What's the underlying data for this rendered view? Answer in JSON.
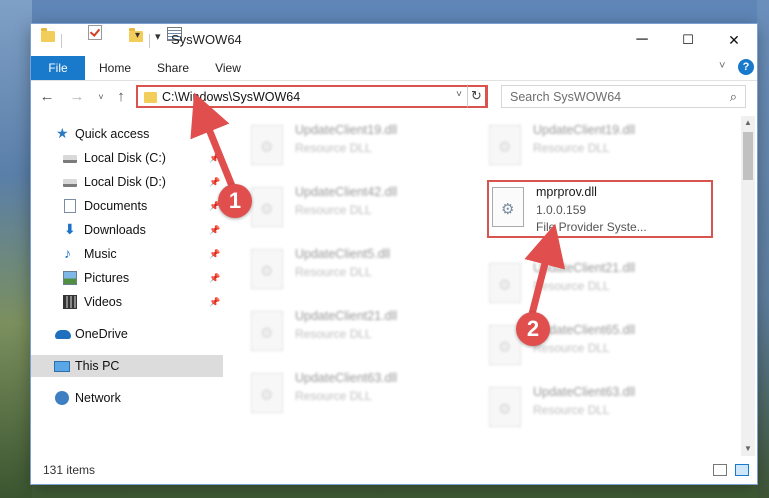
{
  "window": {
    "title": "SysWOW64",
    "minimize": "─",
    "maximize": "☐",
    "close": "✕"
  },
  "ribbon": {
    "tabs": [
      "File",
      "Home",
      "Share",
      "View"
    ],
    "help": "?"
  },
  "address": {
    "path": "C:\\Windows\\SysWOW64",
    "search_placeholder": "Search SysWOW64"
  },
  "nav": {
    "items": [
      {
        "label": "Quick access",
        "icon": "star-icon"
      },
      {
        "label": "Local Disk (C:)",
        "icon": "drive-icon",
        "pinned": true
      },
      {
        "label": "Local Disk (D:)",
        "icon": "drive-icon",
        "pinned": true
      },
      {
        "label": "Documents",
        "icon": "documents-icon",
        "pinned": true
      },
      {
        "label": "Downloads",
        "icon": "downloads-icon",
        "pinned": true
      },
      {
        "label": "Music",
        "icon": "music-icon",
        "pinned": true
      },
      {
        "label": "Pictures",
        "icon": "pictures-icon",
        "pinned": true
      },
      {
        "label": "Videos",
        "icon": "videos-icon",
        "pinned": true
      },
      {
        "label": "OneDrive",
        "icon": "onedrive-icon"
      },
      {
        "label": "This PC",
        "icon": "this-pc-icon",
        "selected": true
      },
      {
        "label": "Network",
        "icon": "network-icon"
      }
    ]
  },
  "files": {
    "left": [
      {
        "name": "UpdateClient19.dll",
        "type": "Resource DLL"
      },
      {
        "name": "UpdateClient42.dll",
        "type": "Resource DLL"
      },
      {
        "name": "UpdateClient5.dll",
        "type": "Resource DLL"
      },
      {
        "name": "UpdateClient21.dll",
        "type": "Resource DLL"
      },
      {
        "name": "UpdateClient63.dll",
        "type": "Resource DLL"
      }
    ],
    "right": [
      {
        "name": "UpdateClient19.dll",
        "type": "Resource DLL"
      },
      {
        "name": "mprprov.dll",
        "version": "1.0.0.159",
        "type": "File Provider Syste..."
      },
      {
        "name": "UpdateClient21.dll",
        "type": "Resource DLL"
      },
      {
        "name": "UpdateClient65.dll",
        "type": "Resource DLL"
      },
      {
        "name": "UpdateClient63.dll",
        "type": "Resource DLL"
      }
    ]
  },
  "status": {
    "item_count": "131 items"
  },
  "callouts": [
    "1",
    "2"
  ],
  "colors": {
    "accent": "#1979ca",
    "highlight": "#d9534f",
    "callout": "#e04e4e"
  }
}
